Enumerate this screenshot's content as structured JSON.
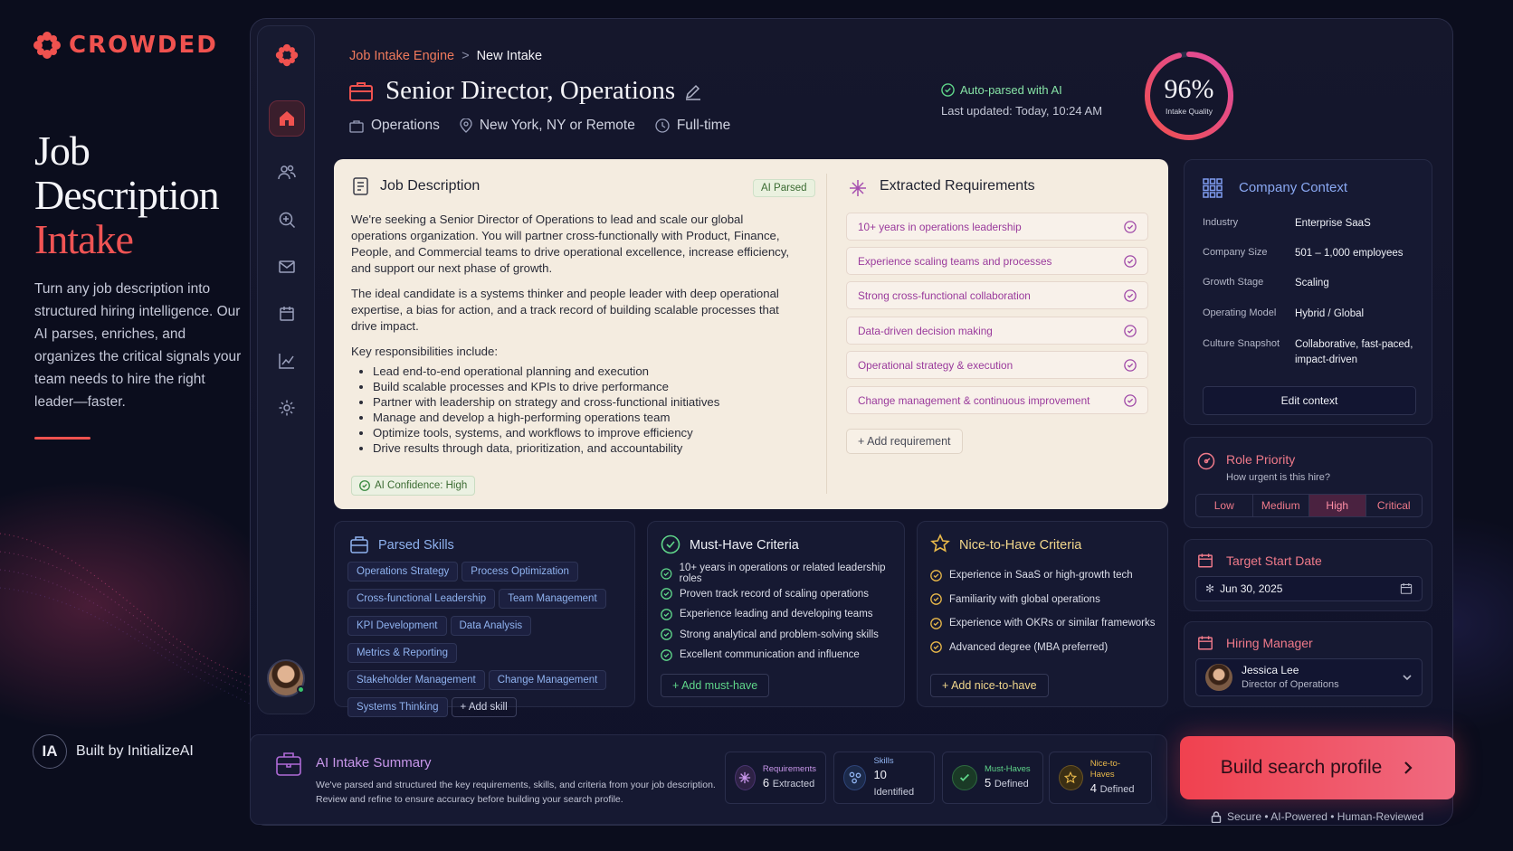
{
  "brand": {
    "name": "CROWDED"
  },
  "hero": {
    "line1": "Job",
    "line2": "Description",
    "accent": "Intake",
    "body": "Turn any job description into structured hiring intelligence. Our AI parses, enriches, and organizes the critical signals your team needs to hire the right leader—faster."
  },
  "built": {
    "badge": "IA",
    "text": "Built by InitializeAI"
  },
  "breadcrumb": {
    "root": "Job Intake Engine",
    "sep": ">",
    "current": "New Intake"
  },
  "job": {
    "title": "Senior Director, Operations",
    "department": "Operations",
    "location": "New York, NY or Remote",
    "type": "Full-time"
  },
  "parse_status": {
    "label": "Auto-parsed with AI",
    "updated": "Last updated: Today, 10:24 AM"
  },
  "quality": {
    "value": "96%",
    "label": "Intake Quality",
    "fraction": 0.96
  },
  "jd": {
    "title": "Job Description",
    "badge": "AI Parsed",
    "p1": "We're seeking a Senior Director of Operations to lead and scale our global operations organization. You will partner cross-functionally with Product, Finance, People, and Commercial teams to drive operational excellence, increase efficiency, and support our next phase of growth.",
    "p2": "The ideal candidate is a systems thinker and people leader with deep operational expertise, a bias for action, and a track record of building scalable processes that drive impact.",
    "resp_heading": "Key responsibilities include:",
    "responsibilities": [
      "Lead end-to-end operational planning and execution",
      "Build scalable processes and KPIs to drive performance",
      "Partner with leadership on strategy and cross-functional initiatives",
      "Manage and develop a high-performing operations team",
      "Optimize tools, systems, and workflows to improve efficiency",
      "Drive results through data, prioritization, and accountability"
    ],
    "confidence": "AI Confidence: High"
  },
  "requirements": {
    "title": "Extracted Requirements",
    "items": [
      "10+ years in operations leadership",
      "Experience scaling teams and processes",
      "Strong cross-functional collaboration",
      "Data-driven decision making",
      "Operational strategy & execution",
      "Change management & continuous improvement"
    ],
    "add_label": "+ Add requirement"
  },
  "skills": {
    "title": "Parsed Skills",
    "items": [
      "Operations Strategy",
      "Process Optimization",
      "Cross-functional Leadership",
      "Team Management",
      "KPI Development",
      "Data Analysis",
      "Metrics & Reporting",
      "Stakeholder Management",
      "Change Management",
      "Systems Thinking"
    ],
    "add_label": "+ Add skill"
  },
  "must": {
    "title": "Must-Have Criteria",
    "items": [
      "10+ years in operations or related leadership roles",
      "Proven track record of scaling operations",
      "Experience leading and developing teams",
      "Strong analytical and problem-solving skills",
      "Excellent communication and influence"
    ],
    "add_label": "+ Add must-have"
  },
  "nice": {
    "title": "Nice-to-Have Criteria",
    "items": [
      "Experience in SaaS or high-growth tech",
      "Familiarity with global operations",
      "Experience with OKRs or similar frameworks",
      "Advanced degree (MBA preferred)"
    ],
    "add_label": "+ Add nice-to-have"
  },
  "context": {
    "title": "Company Context",
    "rows": [
      {
        "k": "Industry",
        "v": "Enterprise SaaS"
      },
      {
        "k": "Company Size",
        "v": "501 – 1,000 employees"
      },
      {
        "k": "Growth Stage",
        "v": "Scaling"
      },
      {
        "k": "Operating Model",
        "v": "Hybrid / Global"
      },
      {
        "k": "Culture Snapshot",
        "v": "Collaborative, fast-paced, impact-driven"
      }
    ],
    "edit_label": "Edit context"
  },
  "priority": {
    "title": "Role Priority",
    "sub": "How urgent is this hire?",
    "options": [
      "Low",
      "Medium",
      "High",
      "Critical"
    ],
    "selected": "High"
  },
  "start": {
    "title": "Target Start Date",
    "value": "Jun 30, 2025"
  },
  "manager": {
    "title": "Hiring Manager",
    "name": "Jessica Lee",
    "role": "Director of Operations"
  },
  "summary": {
    "title": "AI Intake Summary",
    "text1": "We've parsed and structured the key requirements, skills, and criteria from your job description.",
    "text2": "Review and refine to ensure accuracy before building your search profile.",
    "stats": [
      {
        "label": "Requirements",
        "num": "6",
        "unit": "Extracted"
      },
      {
        "label": "Skills",
        "num": "10",
        "unit": "Identified"
      },
      {
        "label": "Must-Haves",
        "num": "5",
        "unit": "Defined"
      },
      {
        "label": "Nice-to-Haves",
        "num": "4",
        "unit": "Defined"
      }
    ]
  },
  "cta": {
    "label": "Build search profile"
  },
  "footer": {
    "secure": "Secure • AI-Powered • Human-Reviewed"
  },
  "colors": {
    "accent": "#f0524f",
    "pink": "#f0414f",
    "purple": "#b06ad8",
    "green": "#37c46b",
    "gold": "#e8b84a"
  }
}
